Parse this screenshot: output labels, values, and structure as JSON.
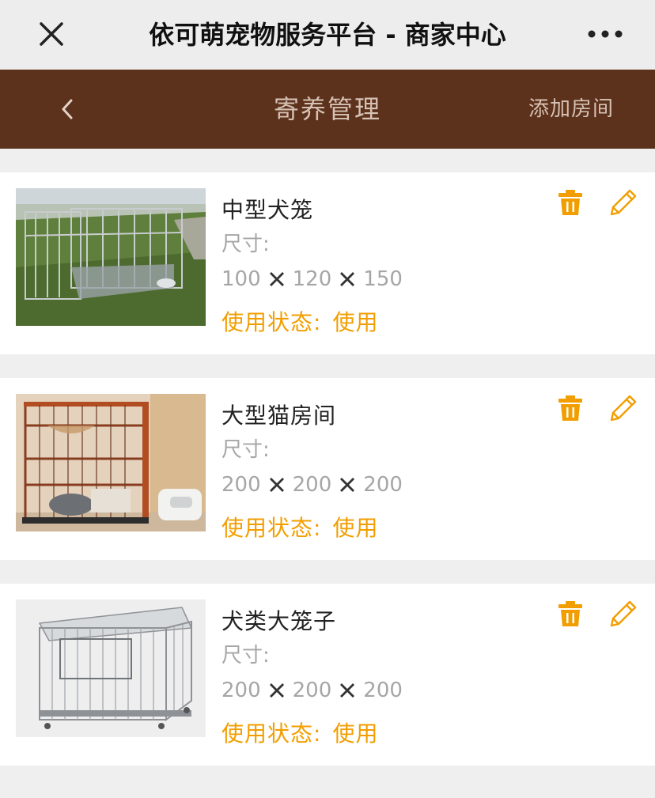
{
  "window": {
    "title": "依可萌宠物服务平台 - 商家中心"
  },
  "nav": {
    "title": "寄养管理",
    "add_label": "添加房间"
  },
  "labels": {
    "size": "尺寸:",
    "status": "使用状态:"
  },
  "colors": {
    "nav_bg": "#5d321c",
    "accent": "#f29e00"
  },
  "rooms": [
    {
      "name": "中型犬笼",
      "dims": [
        "100",
        "120",
        "150"
      ],
      "status": "使用",
      "image": "outdoor-dog-cage-photo"
    },
    {
      "name": "大型猫房间",
      "dims": [
        "200",
        "200",
        "200"
      ],
      "status": "使用",
      "image": "wooden-cat-house-photo"
    },
    {
      "name": "犬类大笼子",
      "dims": [
        "200",
        "200",
        "200"
      ],
      "status": "使用",
      "image": "steel-dog-cage-photo"
    }
  ]
}
